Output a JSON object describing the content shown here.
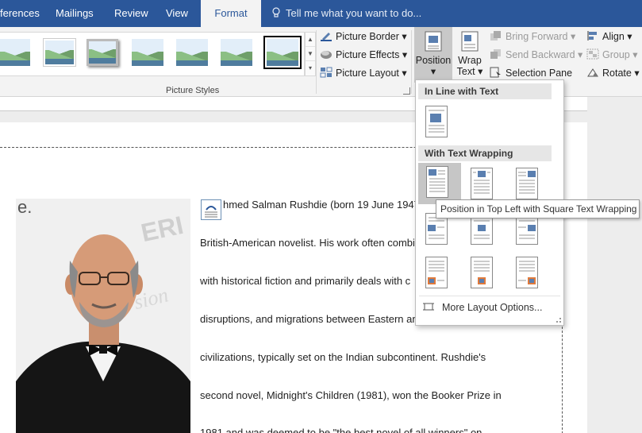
{
  "tabs": {
    "references": "ferences",
    "mailings": "Mailings",
    "review": "Review",
    "view": "View",
    "format": "Format"
  },
  "tell_me": "Tell me what you want to do...",
  "ribbon": {
    "picture_styles_label": "Picture Styles",
    "picture_border": "Picture Border",
    "picture_effects": "Picture Effects",
    "picture_layout": "Picture Layout",
    "position": "Position",
    "wrap_text_line1": "Wrap",
    "wrap_text_line2": "Text",
    "bring_forward": "Bring Forward",
    "send_backward": "Send Backward",
    "selection_pane": "Selection Pane",
    "align": "Align",
    "group": "Group",
    "rotate": "Rotate"
  },
  "position_menu": {
    "in_line_header": "In Line with Text",
    "wrapping_header": "With Text Wrapping",
    "more_layout": "More Layout Options...",
    "tooltip": "Position in Top Left with Square Text Wrapping"
  },
  "document": {
    "photo_caption_fragment": "e.",
    "photo_watermark_fragment": "ERI",
    "photo_watermark_fragment2": "sion",
    "lines": [
      "hmed Salman Rushdie (born 19 June 1947",
      "British-American novelist. His work often combi",
      "with historical fiction and primarily deals with c",
      "disruptions, and migrations between Eastern an",
      "civilizations, typically set on the Indian subcontinent. Rushdie's",
      "second novel, Midnight's Children (1981), won the Booker Prize in",
      "1981 and was deemed to be \"the best novel of all winners\" on"
    ]
  },
  "colors": {
    "tab_bar": "#2b579a",
    "ribbon_bg": "#f3f3f3",
    "hover_bg": "#c6c6c6"
  }
}
